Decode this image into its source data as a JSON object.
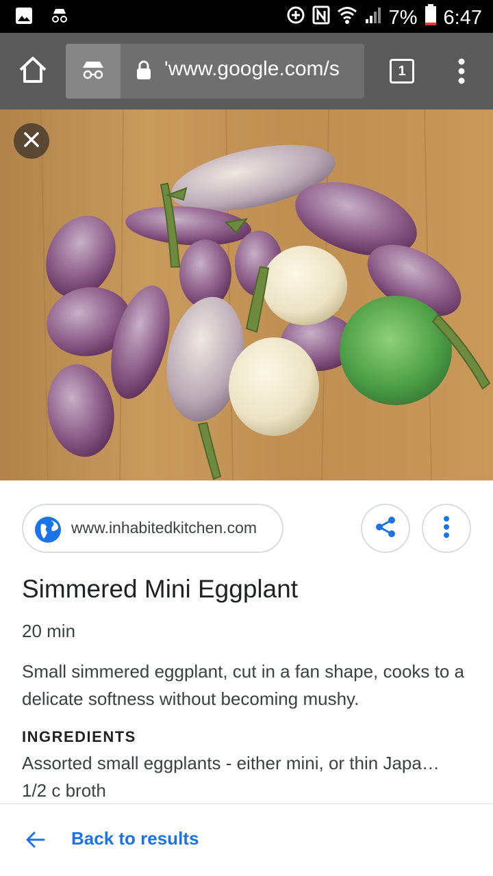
{
  "status_bar": {
    "battery": "7%",
    "time": "6:47",
    "icons": [
      "gallery-icon",
      "incognito-icon",
      "data-saver-icon",
      "nfc-icon",
      "wifi-icon",
      "signal-icon",
      "battery-icon"
    ]
  },
  "browser": {
    "url": "'www.google.com/s",
    "tab_count": "1",
    "icons": [
      "home-icon",
      "incognito-icon",
      "lock-icon",
      "more-vert-icon"
    ]
  },
  "result": {
    "source": "www.inhabitedkitchen.com",
    "title": "Simmered Mini Eggplant",
    "duration": "20 min",
    "description": "Small simmered eggplant, cut in a fan shape, cooks to a delicate softness without becoming mushy.",
    "ingredients_heading": "INGREDIENTS",
    "ingredients": [
      "Assorted small eggplants - either mini, or thin Japa…",
      "1/2 c broth"
    ]
  },
  "footer": {
    "back_label": "Back to results"
  },
  "colors": {
    "accent": "#1a73e8",
    "toolbar": "#5a5a5a",
    "status_bar": "#000000"
  }
}
